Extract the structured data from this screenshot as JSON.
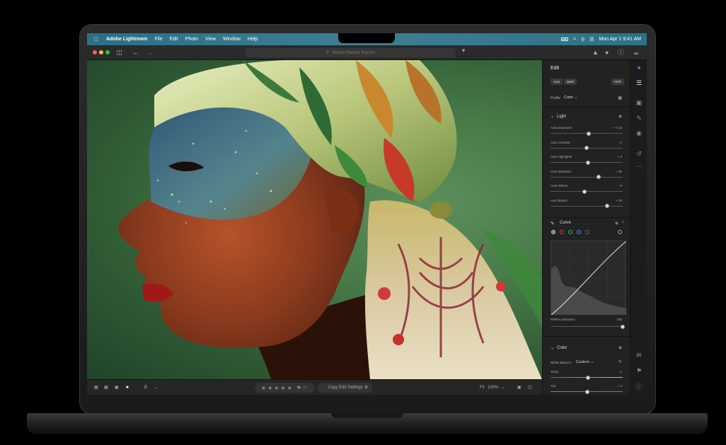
{
  "menubar": {
    "app_name": "Adobe Lightroom",
    "menus": [
      "File",
      "Edit",
      "Photo",
      "View",
      "Window",
      "Help"
    ],
    "clock": "Mon Apr 1  9:41 AM"
  },
  "toolbar": {
    "search_placeholder": "Search Recent Imports"
  },
  "bottombar": {
    "copy_label": "Copy Edit Settings",
    "fit_label": "Fit",
    "zoom_label": "100%"
  },
  "panel": {
    "title": "Edit",
    "buttons": {
      "auto": "Auto",
      "bw": "B&W",
      "hdr": "HDR"
    },
    "profile_label": "Profile",
    "profile_value": "Color",
    "light_title": "Light",
    "sliders": [
      {
        "label": "Auto Exposure",
        "value": "+ 0.15",
        "pos": 0.53
      },
      {
        "label": "Auto Contrast",
        "value": "- 2",
        "pos": 0.5
      },
      {
        "label": "Auto Highlights",
        "value": "+ 3",
        "pos": 0.52
      },
      {
        "label": "Auto Shadows",
        "value": "+ 35",
        "pos": 0.67
      },
      {
        "label": "Auto Whites",
        "value": "- 8",
        "pos": 0.47
      },
      {
        "label": "Auto Blacks",
        "value": "+ 33",
        "pos": 0.78
      }
    ],
    "curve_title": "Curve",
    "refine_label": "Refine Saturation",
    "refine_value": "100",
    "color_title": "Color",
    "wb_label": "White Balance",
    "wb_value": "Custom",
    "temp_label": "Temp",
    "temp_value": "- 1",
    "tint_label": "Tint",
    "tint_value": "+ 2"
  },
  "colors": {
    "menubar": "#3a7f91",
    "panel": "#222222",
    "photo_background": "#487a48",
    "accent": "#4a8fe0"
  }
}
